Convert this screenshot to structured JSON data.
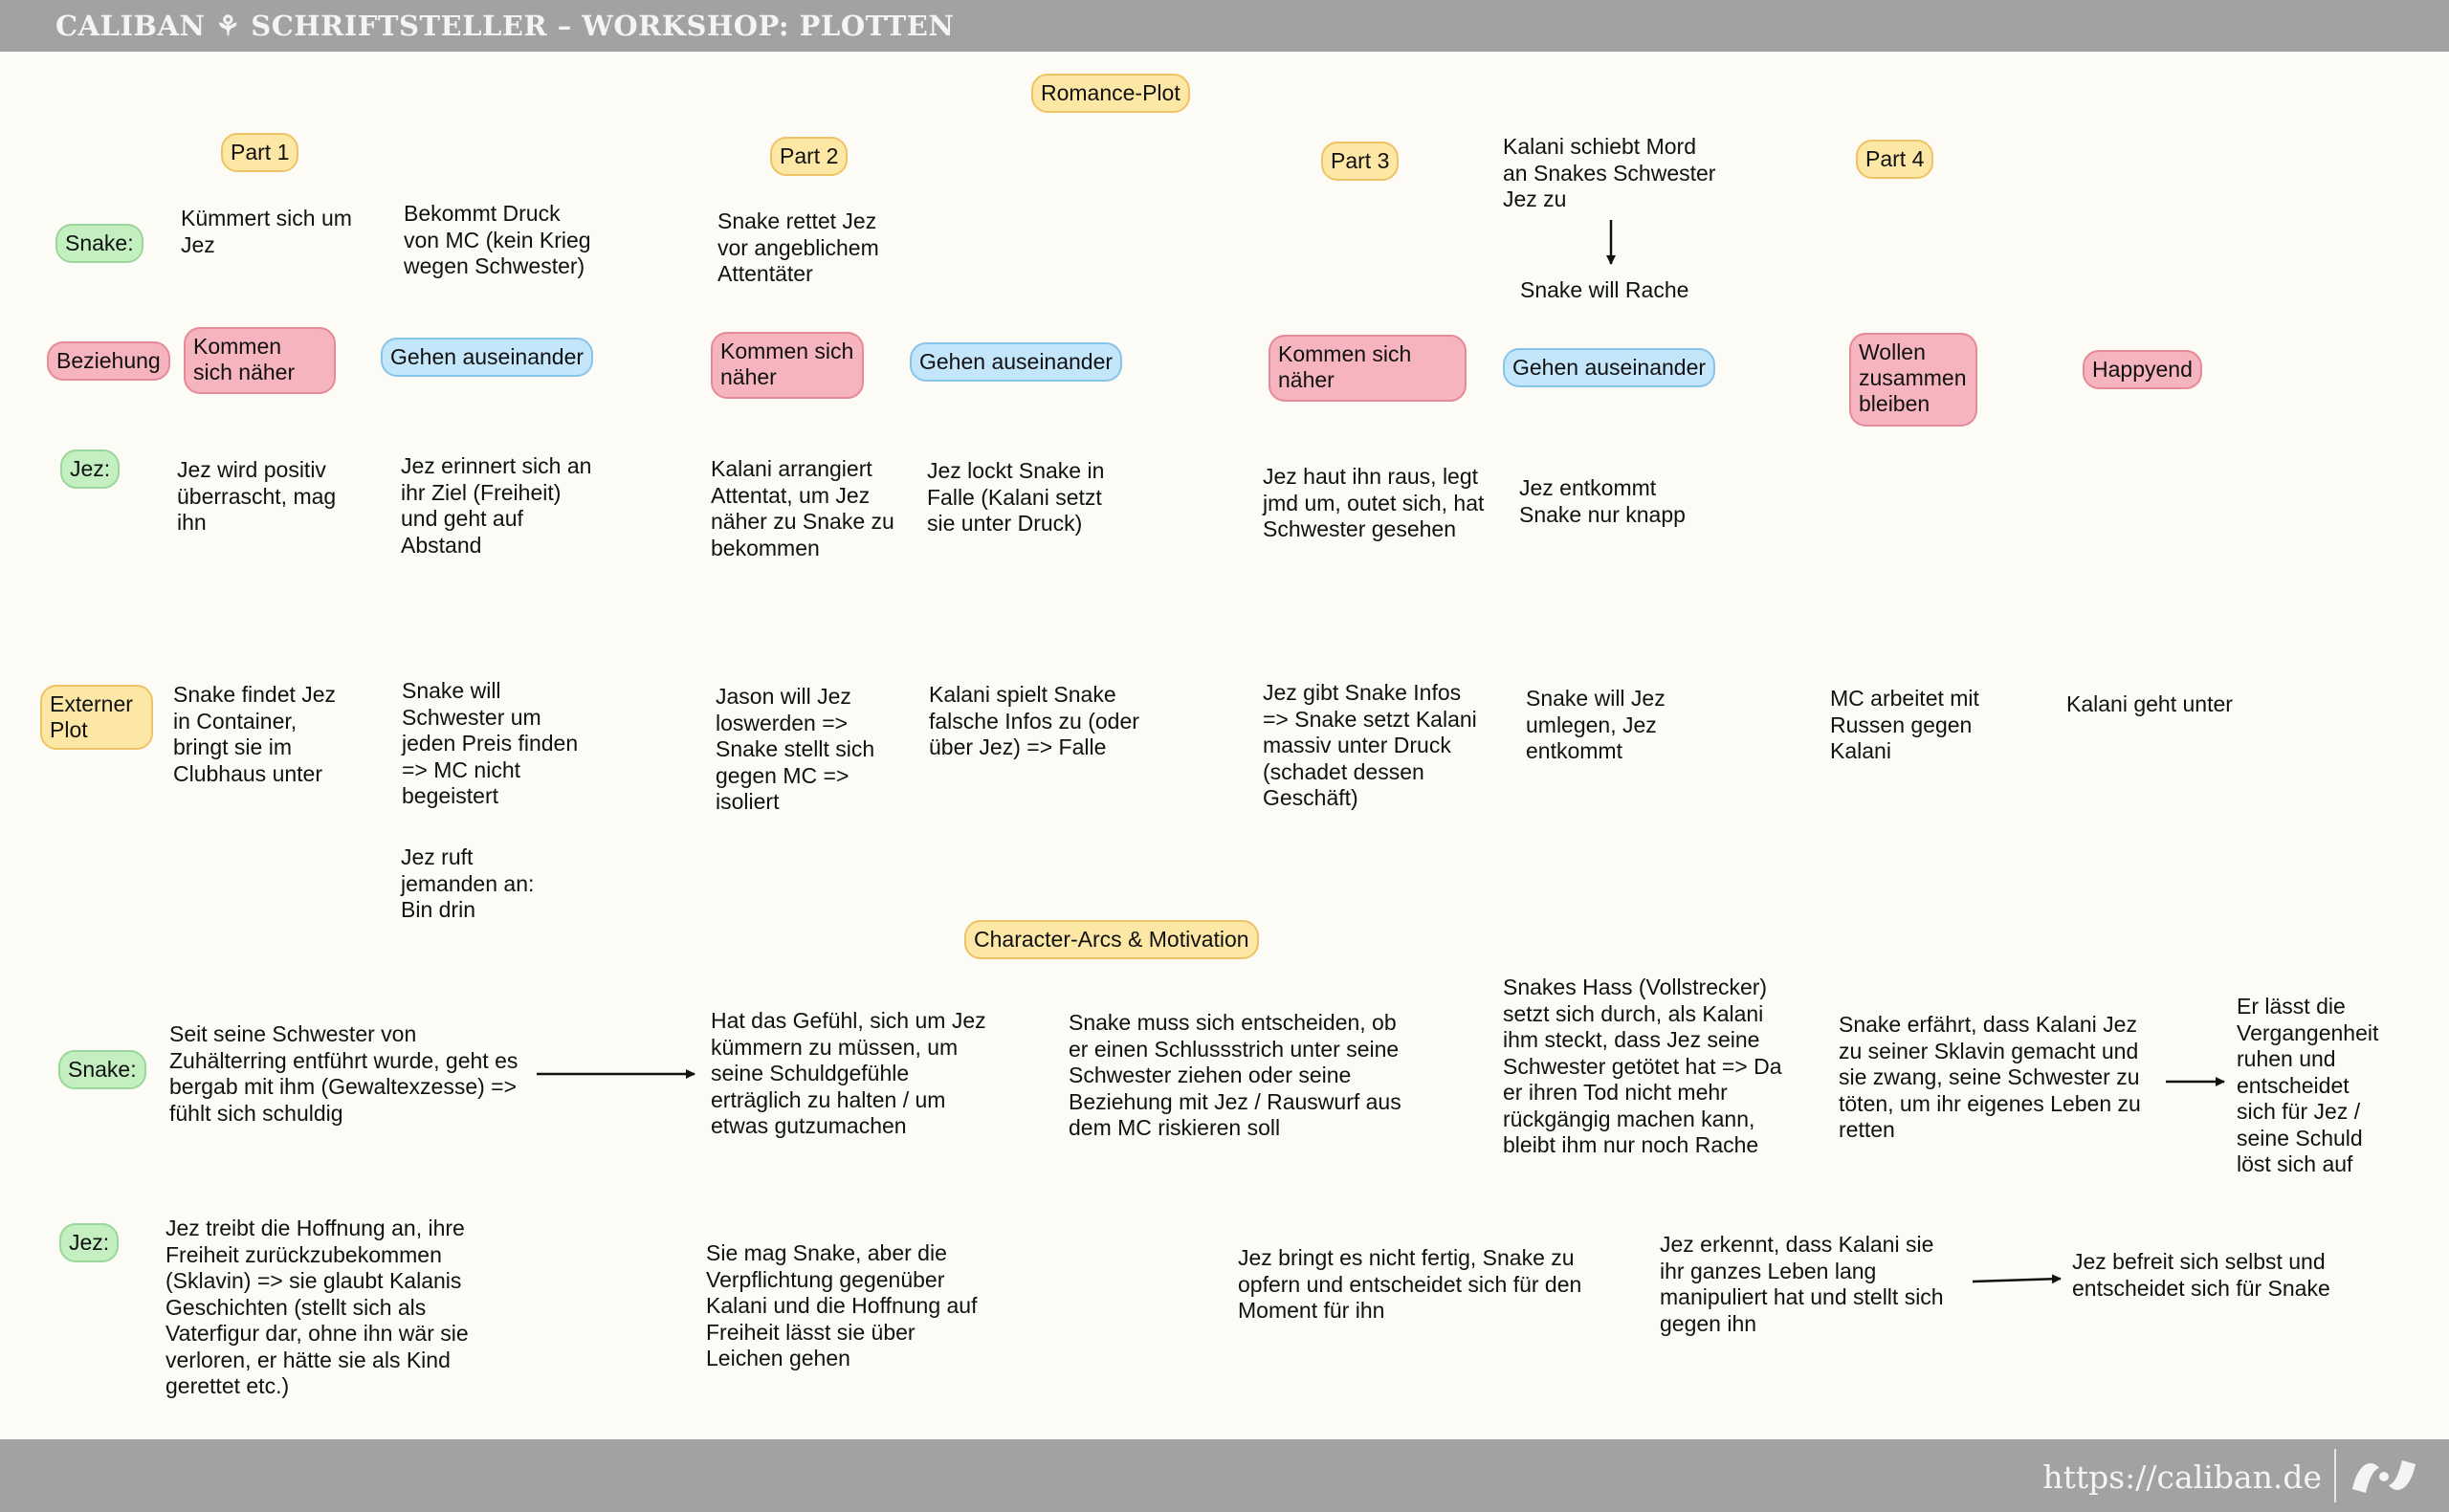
{
  "header": {
    "title": "CALIBAN ⚘ SCHRIFTSTELLER – WORKSHOP: PLOTTEN"
  },
  "footer": {
    "url": "https://caliban.de"
  },
  "romance": {
    "title": "Romance-Plot",
    "parts": [
      "Part 1",
      "Part 2",
      "Part 3",
      "Part 4"
    ],
    "row_labels": {
      "snake": "Snake:",
      "beziehung": "Beziehung",
      "jez": "Jez:",
      "extern": "Externer Plot"
    },
    "snake": [
      "Kümmert sich um\nJez",
      "Bekommt Druck\nvon MC (kein Krieg\nwegen Schwester)",
      "Snake rettet Jez\nvor angeblichem\nAttentäter",
      "Kalani schiebt Mord\nan Snakes Schwester\nJez zu",
      "Snake will Rache"
    ],
    "beziehung": [
      "Kommen sich\nnäher",
      "Gehen auseinander",
      "Kommen sich\nnäher",
      "Gehen auseinander",
      "Kommen sich\nnäher",
      "Gehen auseinander",
      "Wollen\nzusammen\nbleiben",
      "Happyend"
    ],
    "jez": [
      "Jez wird positiv\nüberrascht, mag\nihn",
      "Jez erinnert sich an\nihr Ziel (Freiheit)\nund geht auf\nAbstand",
      "Kalani arrangiert\nAttentat, um Jez\nnäher zu Snake zu\nbekommen",
      "Jez lockt Snake in\nFalle (Kalani setzt\nsie unter Druck)",
      "Jez haut ihn raus, legt\njmd um, outet sich, hat\nSchwester gesehen",
      "Jez entkommt\nSnake nur knapp"
    ],
    "extern": [
      "Snake findet Jez\nin Container,\nbringt sie im\nClubhaus unter",
      "Snake will\nSchwester um\njeden Preis finden\n=> MC nicht\nbegeistert",
      "Jez ruft\njemanden an:\nBin drin",
      "Jason will Jez\nloswerden =>\nSnake stellt sich\ngegen MC =>\nisoliert",
      "Kalani spielt Snake\nfalsche Infos zu (oder\nüber Jez) => Falle",
      "Jez gibt Snake Infos\n=> Snake setzt Kalani\nmassiv unter Druck\n(schadet dessen\nGeschäft)",
      "Snake will Jez\numlegen, Jez\nentkommt",
      "MC arbeitet mit\nRussen gegen\nKalani",
      "Kalani geht unter"
    ]
  },
  "arcs": {
    "title": "Character-Arcs & Motivation",
    "row_labels": {
      "snake": "Snake:",
      "jez": "Jez:"
    },
    "snake": [
      "Seit seine Schwester von\nZuhälterring entführt wurde, geht es\nbergab mit ihm (Gewaltexzesse) =>\nfühlt sich schuldig",
      "Hat das Gefühl, sich um Jez\nkümmern zu müssen, um\nseine Schuldgefühle\nerträglich zu halten / um\netwas gutzumachen",
      "Snake muss sich entscheiden, ob\ner einen Schlussstrich unter seine\nSchwester ziehen oder seine\nBeziehung mit Jez / Rauswurf aus\ndem MC riskieren soll",
      "Snakes Hass (Vollstrecker)\nsetzt sich durch, als Kalani\nihm steckt, dass Jez seine\nSchwester getötet hat => Da\ner ihren Tod nicht mehr\nrückgängig machen kann,\nbleibt ihm nur noch Rache",
      "Snake erfährt, dass Kalani Jez\nzu seiner Sklavin gemacht und\nsie zwang, seine Schwester zu\ntöten, um ihr eigenes Leben zu\nretten",
      "Er lässt die\nVergangenheit\nruhen und\nentscheidet\nsich für Jez /\nseine Schuld\nlöst sich auf"
    ],
    "jez": [
      "Jez treibt die Hoffnung an, ihre\nFreiheit zurückzubekommen\n(Sklavin) => sie glaubt Kalanis\nGeschichten (stellt sich als\nVaterfigur dar, ohne ihn wär sie\nverloren, er hätte sie als Kind\ngerettet etc.)",
      "Sie mag Snake, aber die\nVerpflichtung gegenüber\nKalani und die Hoffnung auf\nFreiheit lässt sie über\nLeichen gehen",
      "Jez bringt es nicht fertig, Snake zu\nopfern und entscheidet sich für den\nMoment für ihn",
      "Jez erkennt, dass Kalani sie\nihr ganzes Leben lang\nmanipuliert hat und stellt sich\ngegen ihn",
      "Jez befreit sich selbst und\nentscheidet sich für Snake"
    ]
  },
  "colors": {
    "green": "#c4efc1",
    "yellow": "#fde7a5",
    "pink": "#f6b4be",
    "blue": "#c4e6fa",
    "bar": "#a2a2a2"
  }
}
